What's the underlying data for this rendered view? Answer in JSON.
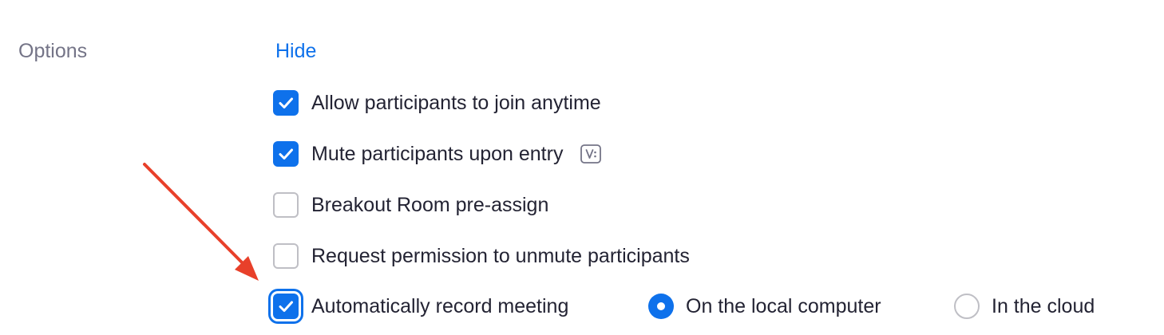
{
  "options": {
    "section_label": "Options",
    "toggle_label": "Hide",
    "items": [
      {
        "label": "Allow participants to join anytime",
        "checked": true
      },
      {
        "label": "Mute participants upon entry",
        "checked": true,
        "info_icon": "video-tutorial-icon"
      },
      {
        "label": "Breakout Room pre-assign",
        "checked": false
      },
      {
        "label": "Request permission to unmute participants",
        "checked": false
      },
      {
        "label": "Automatically record meeting",
        "checked": true,
        "focused": true
      }
    ],
    "record_location": {
      "options": [
        {
          "label": "On the local computer",
          "selected": true
        },
        {
          "label": "In the cloud",
          "selected": false
        }
      ]
    }
  },
  "annotation": {
    "icon": "red-arrow-icon",
    "color": "#e8402a"
  },
  "colors": {
    "accent": "#0e71eb",
    "label_gray": "#747487",
    "text": "#232333",
    "border": "#bfbfc5"
  }
}
